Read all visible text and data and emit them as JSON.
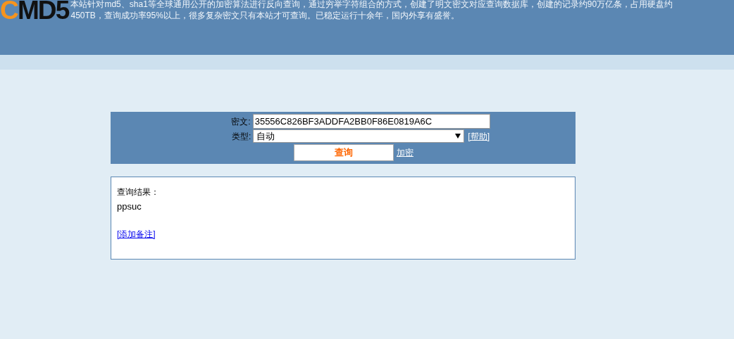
{
  "logo": {
    "accent": "C",
    "rest": "MD5"
  },
  "header": {
    "description": "本站针对md5、sha1等全球通用公开的加密算法进行反向查询，通过穷举字符组合的方式，创建了明文密文对应查询数据库，创建的记录约90万亿条，占用硬盘约450TB，查询成功率95%以上，很多复杂密文只有本站才可查询。已稳定运行十余年，国内外享有盛誉。"
  },
  "form": {
    "cipher_label": "密文:",
    "cipher_value": "35556C826BF3ADDFA2BB0F86E0819A6C",
    "type_label": "类型:",
    "type_value": "自动",
    "help_link": "[帮助]",
    "query_button": "查询",
    "encrypt_link": "加密"
  },
  "result": {
    "title": "查询结果：",
    "value": "ppsuc",
    "add_note_link": "[添加备注]"
  }
}
